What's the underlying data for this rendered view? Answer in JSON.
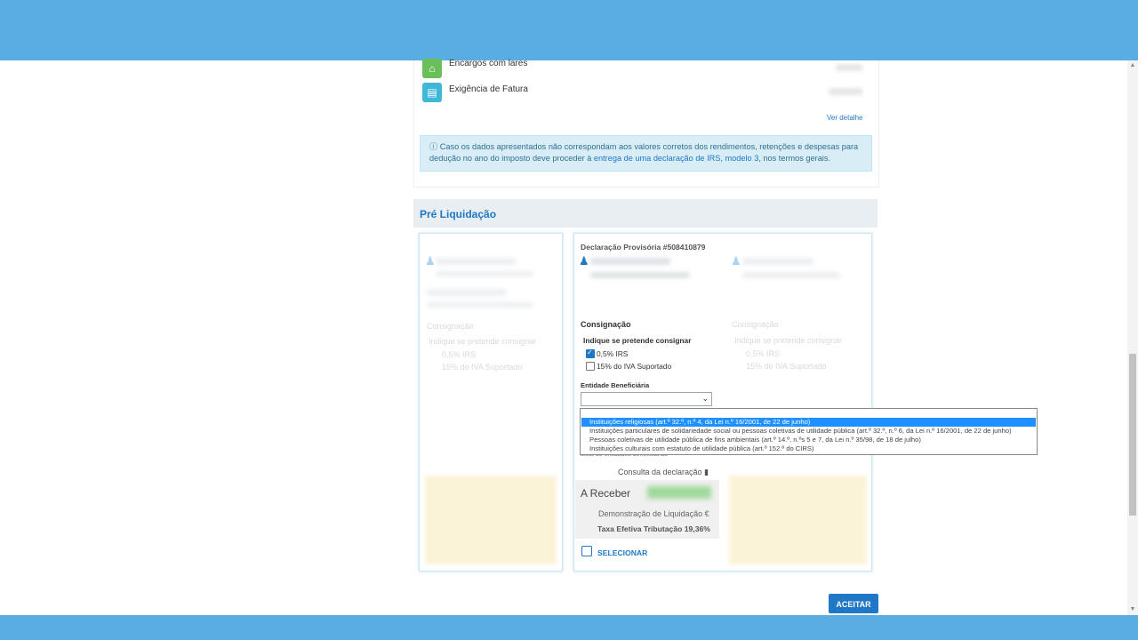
{
  "rows": [
    {
      "label": "Encargos com lares",
      "icon": "house-icon",
      "color": "#6bbf59"
    },
    {
      "label": "Exigência de Fatura",
      "icon": "invoice-icon",
      "color": "#3fb7d6"
    }
  ],
  "ver_detalhe": "Ver detalhe",
  "info": {
    "text_before": "Caso os dados apresentados não correspondam aos valores corretos dos rendimentos, retenções e despesas para dedução no ano do imposto deve proceder à ",
    "link": "entrega de uma declaração de IRS, modelo 3",
    "text_after": ", nos termos gerais."
  },
  "section_title": "Pré Liquidação",
  "ghost_panel": {
    "consignacao": "Consignação",
    "indique": "Indique se pretende consignar",
    "opt1": "0,5% IRS",
    "opt2": "15% do IVA Suportado"
  },
  "center_panel": {
    "declaracao": "Declaração Provisória #508410879",
    "consignacao": "Consignação",
    "indique": "Indique se pretende consignar",
    "irs_label": "0,5% IRS",
    "irs_checked": true,
    "iva_label": "15% do IVA Suportado",
    "iva_checked": false,
    "entidade_label": "Entidade Beneficiária",
    "lista": "Lista de entidades beneficiárias",
    "consulta": "Consulta da declaração",
    "a_receber": "A Receber",
    "demonstracao": "Demonstração de Liquidação €",
    "taxa": "Taxa Efetiva Tributação 19,36%",
    "selecionar": "SELECIONAR"
  },
  "dropdown_options": [
    "Instituições religiosas (art.º 32.º, n.º 4, da Lei n.º 16/2001, de 22 de junho)",
    "Instituições particulares de solidariedade social ou pessoas coletivas de utilidade pública (art.º 32.º, n.º 6, da Lei n.º 16/2001, de 22 de junho)",
    "Pessoas coletivas de utilidade pública de fins ambientais (art.º 14.º, n.ºs 5 e 7, da Lei n.º 35/98, de 18 de julho)",
    "Instituições culturais com estatuto de utilidade pública (art.º 152.º do CIRS)"
  ],
  "dropdown_selected_index": 0,
  "aceitar": "ACEITAR",
  "colors": {
    "accent": "#1f77c5",
    "bar": "#5aade0",
    "selected": "#1e90ff"
  }
}
